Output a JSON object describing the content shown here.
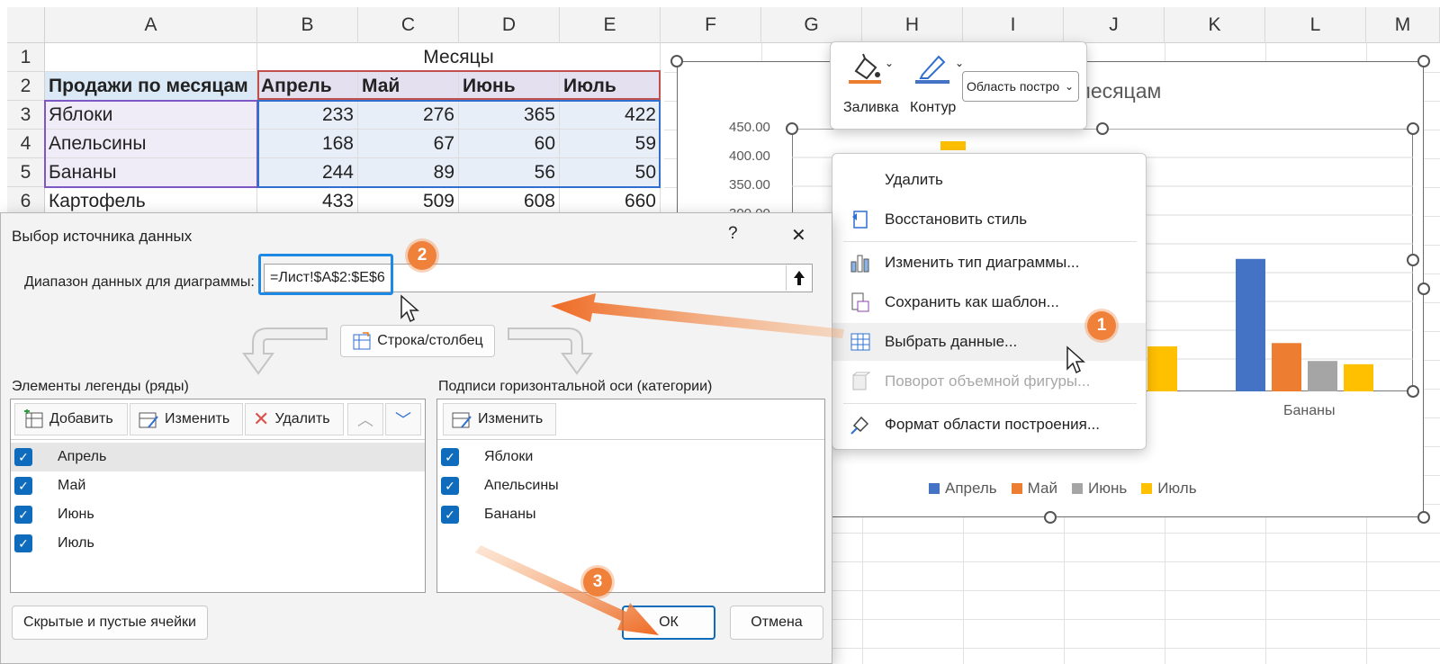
{
  "sheet": {
    "columns": [
      "A",
      "B",
      "C",
      "D",
      "E",
      "F",
      "G",
      "H",
      "I",
      "J",
      "K",
      "L",
      "M"
    ],
    "rows": [
      "1",
      "2",
      "3",
      "4",
      "5",
      "6"
    ],
    "header_months": "Месяцы",
    "row2": [
      "Продажи по месяцам",
      "Апрель",
      "Май",
      "Июнь",
      "Июль"
    ],
    "data": [
      {
        "name": "Яблоки",
        "v": [
          "233",
          "276",
          "365",
          "422"
        ]
      },
      {
        "name": "Апельсины",
        "v": [
          "168",
          "67",
          "60",
          "59"
        ]
      },
      {
        "name": "Бананы",
        "v": [
          "244",
          "89",
          "56",
          "50"
        ]
      },
      {
        "name": "Картофель",
        "v": [
          "433",
          "509",
          "608",
          "660"
        ]
      }
    ]
  },
  "chart": {
    "title_fragment": "месяцам",
    "y_ticks": [
      "450.00",
      "400.00",
      "350.00",
      "300.00"
    ],
    "category_label": "Бананы",
    "legend": [
      {
        "name": "Апрель",
        "color": "#4472c4"
      },
      {
        "name": "Май",
        "color": "#ed7d31"
      },
      {
        "name": "Июнь",
        "color": "#a5a5a5"
      },
      {
        "name": "Июль",
        "color": "#ffc000"
      }
    ]
  },
  "chart_data": {
    "type": "bar",
    "categories": [
      "Бананы"
    ],
    "series": [
      {
        "name": "Апрель",
        "values": [
          244
        ]
      },
      {
        "name": "Май",
        "values": [
          89
        ]
      },
      {
        "name": "Июнь",
        "values": [
          56
        ]
      },
      {
        "name": "Июль",
        "values": [
          50
        ]
      }
    ],
    "ylim": [
      0,
      450
    ],
    "legend_position": "bottom"
  },
  "format_toolbar": {
    "fill_label": "Заливка",
    "outline_label": "Контур",
    "area_select_value": "Область постро"
  },
  "context_menu": {
    "items": [
      {
        "label": "Удалить",
        "enabled": true
      },
      {
        "label": "Восстановить стиль",
        "enabled": true
      },
      {
        "label": "Изменить тип диаграммы...",
        "enabled": true
      },
      {
        "label": "Сохранить как шаблон...",
        "enabled": true
      },
      {
        "label": "Выбрать данные...",
        "enabled": true
      },
      {
        "label": "Поворот объемной фигуры...",
        "enabled": false
      },
      {
        "label": "Формат области построения...",
        "enabled": true
      }
    ]
  },
  "dialog": {
    "title": "Выбор источника данных",
    "help": "?",
    "close": "✕",
    "range_label": "Диапазон данных для диаграммы:",
    "range_value": "=Лист!$A$2:$E$6",
    "switch_button": "Строка/столбец",
    "legend_title": "Элементы легенды (ряды)",
    "add": "Добавить",
    "edit": "Изменить",
    "remove": "Удалить",
    "series": [
      "Апрель",
      "Май",
      "Июнь",
      "Июль"
    ],
    "axis_title": "Подписи горизонтальной оси (категории)",
    "axis_edit": "Изменить",
    "categories": [
      "Яблоки",
      "Апельсины",
      "Бананы"
    ],
    "hidden_button": "Скрытые и пустые ячейки",
    "ok": "ОК",
    "cancel": "Отмена"
  },
  "badges": [
    "1",
    "2",
    "3"
  ],
  "colors": {
    "accent": "#0f6cbd",
    "badge": "#f0813a"
  }
}
